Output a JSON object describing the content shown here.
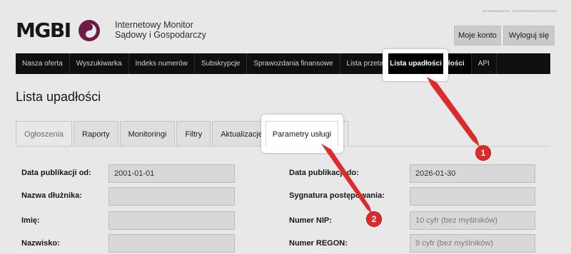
{
  "header": {
    "brand": "MGBI",
    "subtitle_line1": "Internetowy Monitor",
    "subtitle_line2": "Sądowy i Gospodarczy",
    "user_email": "••••••••••• ••••••••••••••••••",
    "my_account": "Moje konto",
    "logout": "Wyloguj się"
  },
  "nav": {
    "items": [
      {
        "label": "Nasza oferta"
      },
      {
        "label": "Wyszukiwarka"
      },
      {
        "label": "Indeks numerów"
      },
      {
        "label": "Subskrypcje"
      },
      {
        "label": "Sprawozdania finansowe"
      },
      {
        "label": "Lista przetargów"
      },
      {
        "label": "Lista upadłości"
      },
      {
        "label": "API"
      }
    ]
  },
  "page": {
    "title": "Lista upadłości"
  },
  "tabs": [
    {
      "label": "Ogłoszenia"
    },
    {
      "label": "Raporty"
    },
    {
      "label": "Monitoringi"
    },
    {
      "label": "Filtry"
    },
    {
      "label": "Aktualizacje"
    },
    {
      "label": "Parametry usługi"
    }
  ],
  "form": {
    "pub_from": {
      "label": "Data publikacji od:",
      "value": "2001-01-01"
    },
    "debtor_name": {
      "label": "Nazwa dłużnika:",
      "value": ""
    },
    "first_name": {
      "label": "Imię:",
      "value": ""
    },
    "last_name": {
      "label": "Nazwisko:",
      "value": ""
    },
    "pub_to": {
      "label": "Data publikacji do:",
      "value": "2026-01-30"
    },
    "case_sig": {
      "label": "Sygnatura postępowania:",
      "value": ""
    },
    "nip": {
      "label": "Numer NIP:",
      "placeholder": "10 cyfr (bez myślników)"
    },
    "regon": {
      "label": "Numer REGON:",
      "placeholder": "9 cyfr (bez myślników)"
    }
  },
  "annotations": [
    {
      "number": "1"
    },
    {
      "number": "2"
    }
  ],
  "colors": {
    "annotation_red": "#dd2a2a",
    "nav_bg": "#111111"
  }
}
